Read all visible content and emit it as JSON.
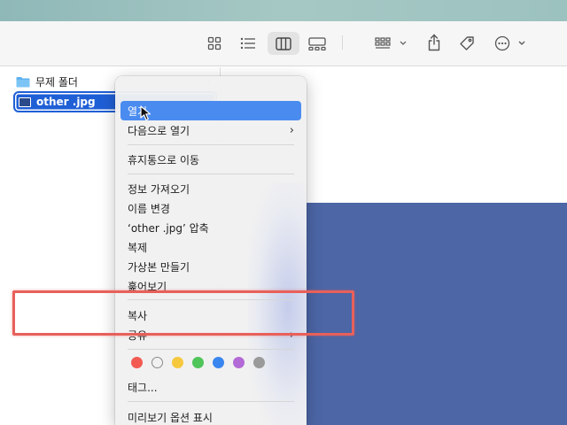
{
  "sidebar": {
    "items": [
      {
        "label": "무제 폴더",
        "icon": "folder-icon"
      },
      {
        "label": "other .jpg",
        "icon": "image-file-icon",
        "selected": true
      }
    ]
  },
  "context_menu": {
    "open": "열기",
    "open_with": "다음으로 열기",
    "move_to_trash": "휴지통으로 이동",
    "get_info": "정보 가져오기",
    "rename": "이름 변경",
    "compress": "‘other .jpg’ 압축",
    "duplicate": "복제",
    "make_alias": "가상본 만들기",
    "quick_look": "훑어보기",
    "copy": "복사",
    "share": "공유",
    "tags": "태그...",
    "show_preview_options": "미리보기 옵션 표시"
  },
  "tag_colors": [
    "#f25a52",
    "empty",
    "#f6c83d",
    "#4fc55a",
    "#3a86f0",
    "#b36ad6",
    "#9a9a9a"
  ],
  "colors": {
    "accent": "#1f5fd6",
    "menu_highlight": "#4a8bf0",
    "annotation": "#e8605a",
    "preview": "#4c66a6"
  }
}
